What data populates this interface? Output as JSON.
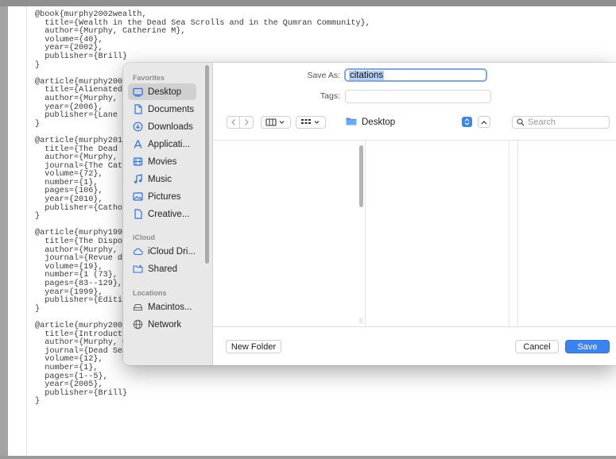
{
  "editor": {
    "lines": [
      "@book{murphy2002wealth,",
      "  title={Wealth in the Dead Sea Scrolls and in the Qumran Community},",
      "  author={Murphy, Catherine M},",
      "  volume={40},",
      "  year={2002},",
      "  publisher={Brill}",
      "}",
      "",
      "@article{murphy200",
      "  title={Alienated",
      "  author={Murphy,",
      "  year={2006},",
      "  publisher={Lane",
      "}",
      "",
      "@article{murphy201",
      "  title={The Dead",
      "  author={Murphy,",
      "  journal={The Cat",
      "  volume={72},",
      "  number={1},",
      "  pages={106},",
      "  year={2010},",
      "  publisher={Catho",
      "}",
      "",
      "@article{murphy199",
      "  title={The Dispo",
      "  author={Murphy,",
      "  journal={Revue d",
      "  volume={19},",
      "  number={1 (73},",
      "  pages={83--129},",
      "  year={1999},",
      "  publisher={Editi",
      "}",
      "",
      "@article{murphy2005introduction,",
      "  title={Introduction: The Dead Sea Scrolls in the Popular Imagination},",
      "  author={Murphy, Catherine and Grossman, Maxine},",
      "  journal={Dead Sea Discoveries},",
      "  volume={12},",
      "  number={1},",
      "  pages={1--5},",
      "  year={2005},",
      "  publisher={Brill}",
      "}"
    ]
  },
  "dialog": {
    "save_as_label": "Save As:",
    "save_as_value": "citations",
    "tags_label": "Tags:",
    "location": "Desktop",
    "search_placeholder": "Search",
    "new_folder": "New Folder",
    "cancel": "Cancel",
    "save": "Save",
    "accent_color": "#3b82f2"
  },
  "sidebar": {
    "favorites_header": "Favorites",
    "icloud_header": "iCloud",
    "locations_header": "Locations",
    "favorites": [
      {
        "label": "Desktop",
        "icon": "desktop-icon",
        "selected": true
      },
      {
        "label": "Documents",
        "icon": "document-icon"
      },
      {
        "label": "Downloads",
        "icon": "download-icon"
      },
      {
        "label": "Applicati...",
        "icon": "applications-icon"
      },
      {
        "label": "Movies",
        "icon": "film-icon"
      },
      {
        "label": "Music",
        "icon": "music-note-icon"
      },
      {
        "label": "Pictures",
        "icon": "photo-icon"
      },
      {
        "label": "Creative...",
        "icon": "file-icon"
      }
    ],
    "icloud": [
      {
        "label": "iCloud Dri...",
        "icon": "cloud-icon"
      },
      {
        "label": "Shared",
        "icon": "shared-folder-icon"
      }
    ],
    "locations": [
      {
        "label": "Macintos...",
        "icon": "hard-drive-icon"
      },
      {
        "label": "Network",
        "icon": "globe-icon"
      }
    ]
  }
}
